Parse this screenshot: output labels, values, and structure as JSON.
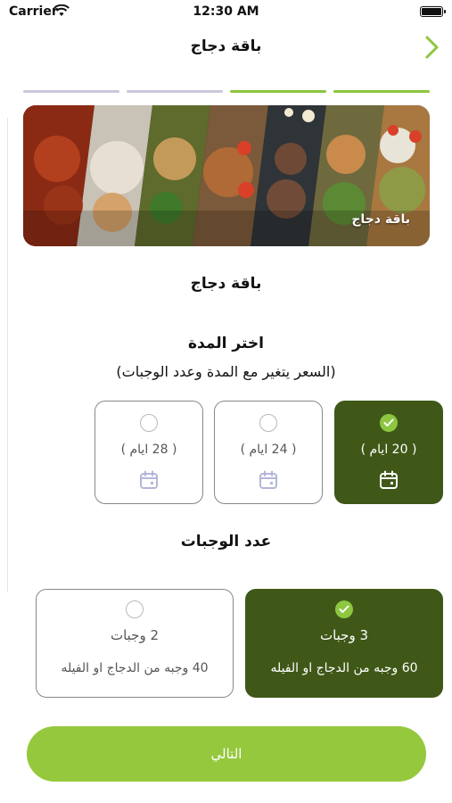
{
  "status_bar": {
    "carrier": "Carrier",
    "time": "12:30 AM"
  },
  "header": {
    "title": "باقة دجاج",
    "back_icon": "chevron-right-icon"
  },
  "progress": {
    "steps_total": 4,
    "steps_done": 2,
    "active_color": "#8dc63f",
    "inactive_color": "#c9c9dc"
  },
  "banner": {
    "label": "باقة دجاج"
  },
  "package": {
    "name": "باقة دجاج"
  },
  "duration": {
    "title": "اختر المدة",
    "note": "(السعر يتغير مع المدة وعدد الوجبات)",
    "options": [
      {
        "label": "( 20 ايام )",
        "selected": true
      },
      {
        "label": "( 24 ايام )",
        "selected": false
      },
      {
        "label": "( 28 ايام )",
        "selected": false
      }
    ]
  },
  "meals": {
    "title": "عدد الوجبات",
    "options": [
      {
        "count": "3 وجبات",
        "description": "60 وجبه من الدجاج او الفيله",
        "selected": true
      },
      {
        "count": "2 وجبات",
        "description": "40 وجبه من الدجاج او الفيله",
        "selected": false
      }
    ]
  },
  "footer": {
    "next_label": "التالي"
  },
  "colors": {
    "selected_bg": "#3f5818",
    "accent": "#8dc63f",
    "button": "#95c83c"
  }
}
